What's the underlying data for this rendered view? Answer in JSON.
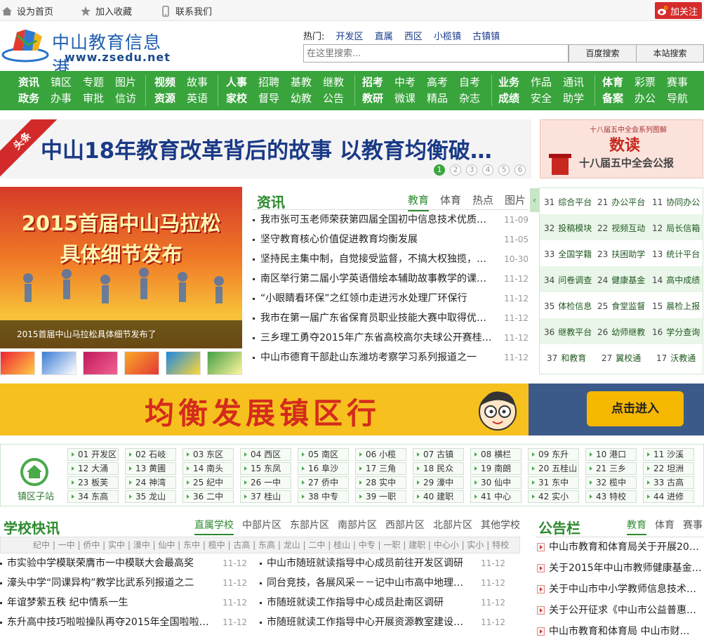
{
  "topbar": {
    "home": "设为首页",
    "fav": "收藏",
    "fav_full": "加入收藏",
    "contact": "联系我们",
    "follow": "加关注"
  },
  "logo": {
    "title": "中山教育信息港",
    "url": "www.zsedu.net"
  },
  "hot": {
    "label": "热门:",
    "links": [
      "开发区",
      "直属",
      "西区",
      "小榄镇",
      "古镇镇"
    ]
  },
  "search": {
    "placeholder": "在这里搜索...",
    "btn_baidu": "百度搜索",
    "btn_site": "本站搜索"
  },
  "nav": [
    {
      "top": [
        "资讯",
        "镇区",
        "专题",
        "图片"
      ],
      "bottom": [
        "政务",
        "办事",
        "审批",
        "信访"
      ]
    },
    {
      "top": [
        "视频",
        "故事"
      ],
      "bottom": [
        "资源",
        "英语"
      ]
    },
    {
      "top": [
        "人事",
        "招聘",
        "基教",
        "继教"
      ],
      "bottom": [
        "家校",
        "督导",
        "幼教",
        "公告"
      ]
    },
    {
      "top": [
        "招考",
        "中考",
        "高考",
        "自考"
      ],
      "bottom": [
        "教研",
        "微课",
        "精品",
        "杂志"
      ]
    },
    {
      "top": [
        "业务",
        "作品",
        "通讯"
      ],
      "bottom": [
        "成绩",
        "安全",
        "助学"
      ]
    },
    {
      "top": [
        "体育",
        "彩票",
        "赛事"
      ],
      "bottom": [
        "备案",
        "办公",
        "导航"
      ]
    }
  ],
  "headline": {
    "tag": "头条",
    "text": "中山18年教育改革背后的故事 以教育均衡破…",
    "dots": [
      "1",
      "2",
      "3",
      "4",
      "5",
      "6"
    ]
  },
  "ad_right": {
    "top": "十八届五中全会系列图解",
    "big": "数读",
    "sub": "十八届五中全会公报"
  },
  "feature": {
    "line1": "2015首届中山马拉松",
    "line2": "具体细节发布",
    "caption": "2015首届中山马拉松具体细节发布了"
  },
  "news": {
    "title": "资讯",
    "tabs": [
      "教育",
      "体育",
      "热点",
      "图片"
    ],
    "items": [
      {
        "t": "我市张可玉老师荣获第四届全国初中信息技术优质课…",
        "d": "11-09"
      },
      {
        "t": "坚守教育核心价值促进教育均衡发展",
        "d": "11-05"
      },
      {
        "t": "坚持民主集中制，自觉接受监督，不搞大权独揽，独…",
        "d": "10-30"
      },
      {
        "t": "南区举行第二届小学英语借绘本辅助故事教学的课堂…",
        "d": "11-12"
      },
      {
        "t": "“小眼睛看环保”之红领巾走进污水处理厂环保行",
        "d": "11-12"
      },
      {
        "t": "我市在第一届广东省保育员职业技能大赛中取得优异…",
        "d": "11-12"
      },
      {
        "t": "三乡理工勇夺2015年广东省高校高尔夫球公开赛桂冠…",
        "d": "11-12"
      },
      {
        "t": "中山市德育干部赴山东潍坊考察学习系列报道之一",
        "d": "11-12"
      }
    ]
  },
  "grid": [
    [
      [
        "31",
        "综合平台"
      ],
      [
        "21",
        "办公平台"
      ],
      [
        "11",
        "协同办公"
      ]
    ],
    [
      [
        "32",
        "投稿模块"
      ],
      [
        "22",
        "视频互动"
      ],
      [
        "12",
        "局长信箱"
      ]
    ],
    [
      [
        "33",
        "全国学籍"
      ],
      [
        "23",
        "扶困助学"
      ],
      [
        "13",
        "统计平台"
      ]
    ],
    [
      [
        "34",
        "问卷调查"
      ],
      [
        "24",
        "健康基金"
      ],
      [
        "14",
        "高中成绩"
      ]
    ],
    [
      [
        "35",
        "体检信息"
      ],
      [
        "25",
        "食堂监督"
      ],
      [
        "15",
        "晨检上报"
      ]
    ],
    [
      [
        "36",
        "继教平台"
      ],
      [
        "26",
        "幼师继教"
      ],
      [
        "16",
        "学分查询"
      ]
    ],
    [
      [
        "37",
        "和教育"
      ],
      [
        "27",
        "翼校通"
      ],
      [
        "17",
        "沃教通"
      ]
    ]
  ],
  "banner": {
    "text": "均衡发展镇区行",
    "btn": "点击进入"
  },
  "towns": {
    "label": "镇区子站",
    "items": [
      "01 开发区",
      "02 石岐",
      "03 东区",
      "04 西区",
      "05 南区",
      "06 小榄",
      "07 古镇",
      "08 横栏",
      "09 东升",
      "10 港口",
      "11 沙溪",
      "12 大涌",
      "13 黄圃",
      "14 南头",
      "15 东凤",
      "16 阜沙",
      "17 三角",
      "18 民众",
      "19 南朗",
      "20 五桂山",
      "21 三乡",
      "22 坦洲",
      "23 板芙",
      "24 神湾",
      "25 纪中",
      "26 一中",
      "27 侨中",
      "28 实中",
      "29 濠中",
      "30 仙中",
      "31 东中",
      "32 榄中",
      "33 古高",
      "34 东高",
      "35 龙山",
      "36 二中",
      "37 桂山",
      "38 中专",
      "39 一职",
      "40 建职",
      "41 中心",
      "42 实小",
      "43 特校",
      "44 进修"
    ]
  },
  "school": {
    "title": "学校快讯",
    "tabs": [
      "直属学校",
      "中部片区",
      "东部片区",
      "南部片区",
      "西部片区",
      "北部片区",
      "其他学校"
    ],
    "strip": "纪中 | 一中 | 侨中 | 实中 | 濠中 | 仙中 | 东中 | 榄中 | 古高 | 东高 | 龙山 | 二中 | 桂山 | 中专 | 一职 | 建职 | 中心小 | 实小 | 特校",
    "left": [
      {
        "t": "市实验中学模联荣膺市一中模联大会最高奖",
        "d": "11-12"
      },
      {
        "t": "濠头中学“同课异构”教学比武系列报道之二",
        "d": "11-12"
      },
      {
        "t": "年谊梦萦五秩 纪中情系一生",
        "d": "11-12"
      },
      {
        "t": "东升高中技巧啦啦操队再夺2015年全国啦啦操…",
        "d": "11-12"
      }
    ],
    "right": [
      {
        "t": "中山市随班就读指导中心成员前往开发区调研",
        "d": "11-12"
      },
      {
        "t": "同台竞技，各展风采－－记中山市高中地理教…",
        "d": "11-12"
      },
      {
        "t": "市随班就读工作指导中心成员赴南区调研",
        "d": "11-12"
      },
      {
        "t": "市随班就读工作指导中心开展资源教室建设检…",
        "d": "11-12"
      }
    ]
  },
  "notice": {
    "title": "公告栏",
    "tabs": [
      "教育",
      "体育",
      "赛事"
    ],
    "items": [
      "中山市教育和体育局关于开展20…",
      "关于2015年中山市教师健康基金…",
      "关于中山市中小学教师信息技术…",
      "关于公开征求《中山市公益普惠…",
      "中山市教育和体育局 中山市财…"
    ]
  }
}
